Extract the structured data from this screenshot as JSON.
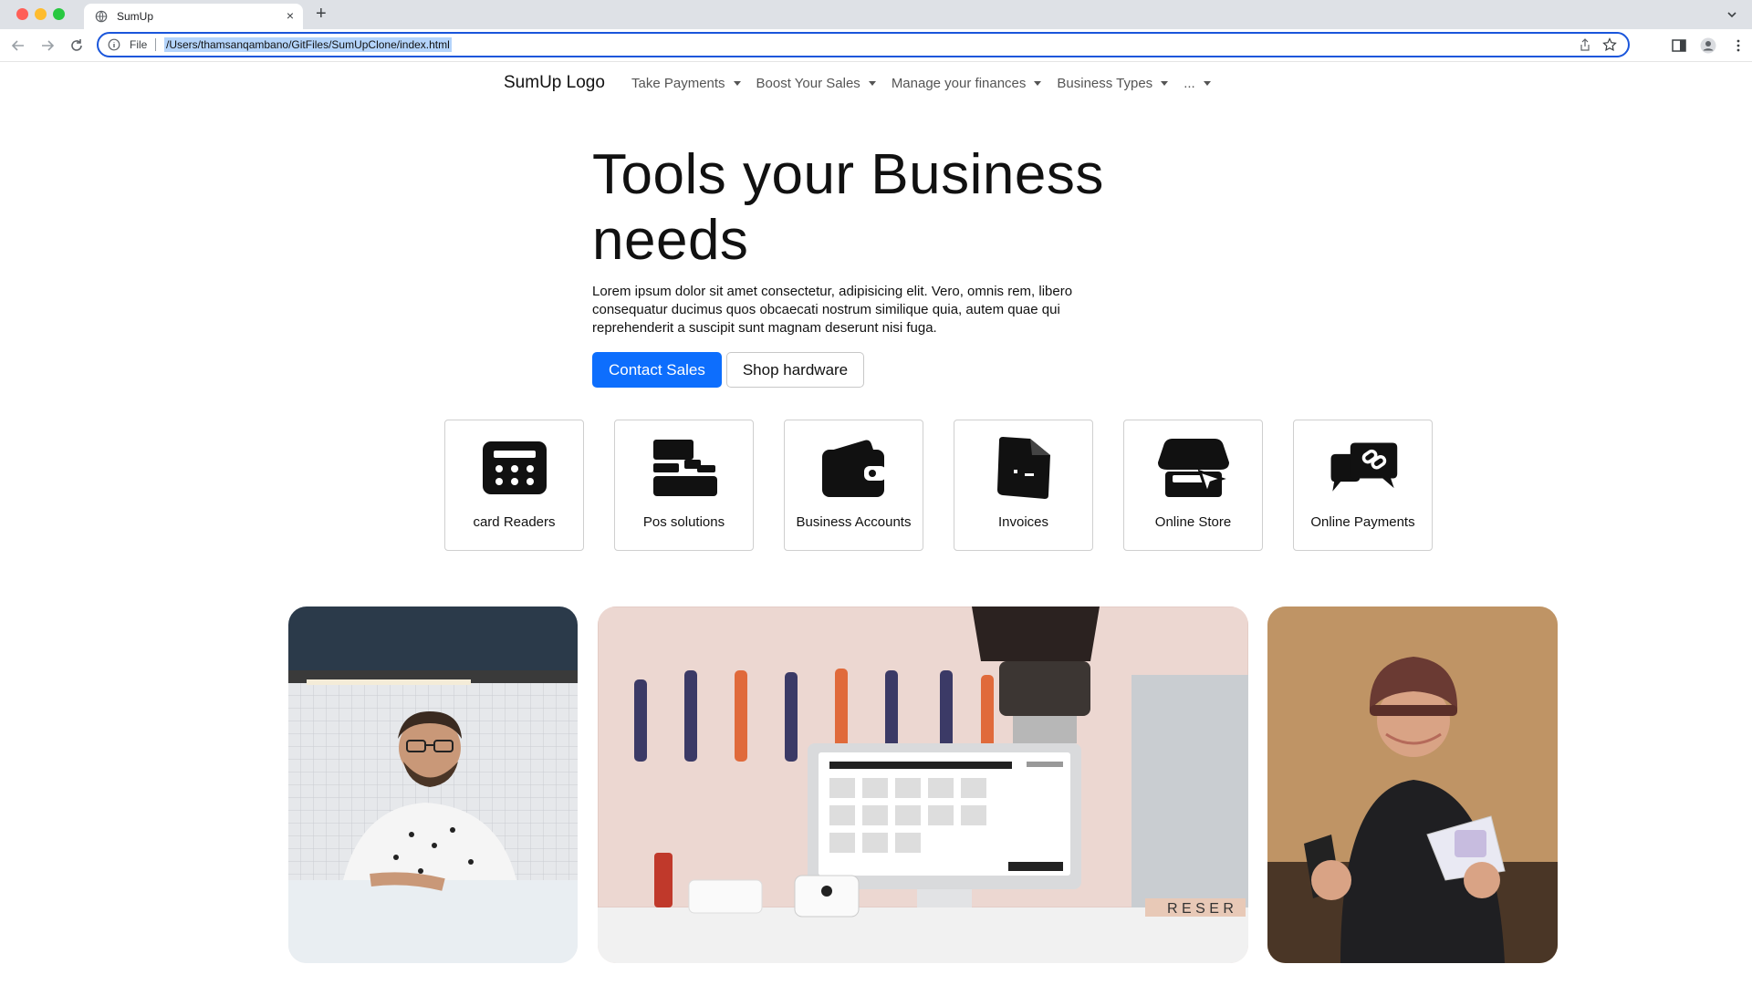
{
  "browser": {
    "tab_title": "SumUp",
    "new_tab_symbol": "+",
    "tab_close_symbol": "×",
    "address_scheme": "File",
    "address_url": "/Users/thamsanqambano/GitFiles/SumUpClone/index.html"
  },
  "nav": {
    "brand": "SumUp Logo",
    "items": [
      {
        "label": "Take Payments"
      },
      {
        "label": "Boost Your Sales"
      },
      {
        "label": "Manage your finances"
      },
      {
        "label": "Business Types"
      },
      {
        "label": "..."
      }
    ]
  },
  "hero": {
    "title_line1": "Tools your Business",
    "title_line2": "needs",
    "description": "Lorem ipsum dolor sit amet consectetur, adipisicing elit. Vero, omnis rem, libero consequatur ducimus quos obcaecati nostrum similique quia, autem quae qui reprehenderit a suscipit sunt magnam deserunt nisi fuga.",
    "primary_button": "Contact Sales",
    "secondary_button": "Shop hardware"
  },
  "cards": [
    {
      "label": "card Readers",
      "icon": "calculator-icon"
    },
    {
      "label": "Pos solutions",
      "icon": "cash-register-icon"
    },
    {
      "label": "Business Accounts",
      "icon": "wallet-icon"
    },
    {
      "label": "Invoices",
      "icon": "invoice-icon"
    },
    {
      "label": "Online Store",
      "icon": "store-icon"
    },
    {
      "label": "Online Payments",
      "icon": "payment-link-icon"
    }
  ],
  "photo_texts": {
    "letter_tiles": "R E S E R"
  },
  "colors": {
    "primary": "#0d6efd",
    "address_highlight": "#b4d4fb",
    "omnibox_border": "#1a56db"
  }
}
